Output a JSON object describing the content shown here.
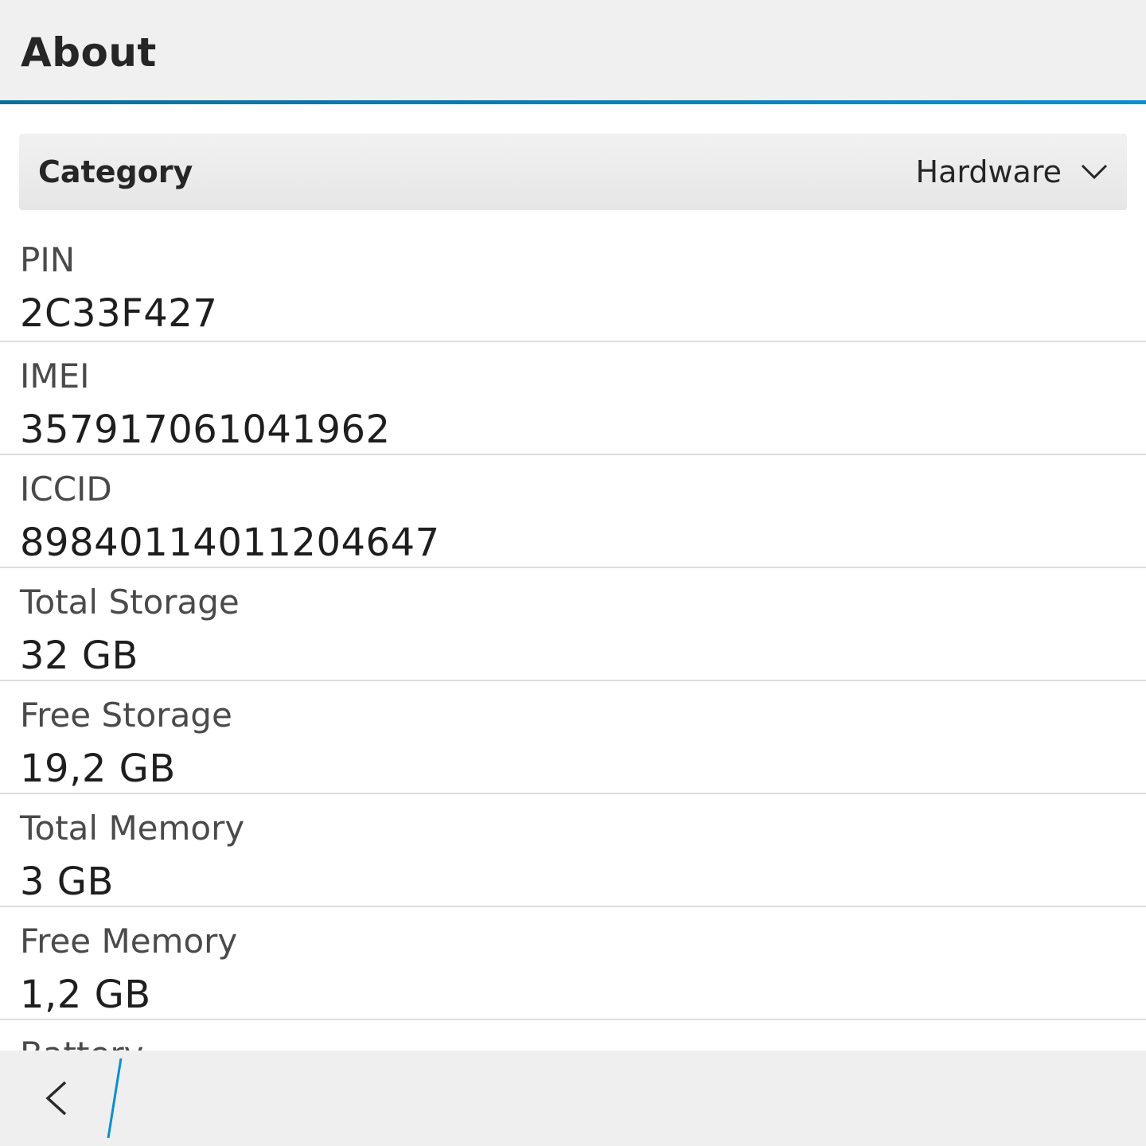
{
  "header": {
    "title": "About"
  },
  "category": {
    "label": "Category",
    "selected": "Hardware"
  },
  "items": [
    {
      "label": "PIN",
      "value": "2C33F427"
    },
    {
      "label": "IMEI",
      "value": "357917061041962"
    },
    {
      "label": "ICCID",
      "value": "89840114011204647"
    },
    {
      "label": "Total Storage",
      "value": "32 GB"
    },
    {
      "label": "Free Storage",
      "value": "19,2 GB"
    },
    {
      "label": "Total Memory",
      "value": "3 GB"
    },
    {
      "label": "Free Memory",
      "value": "1,2 GB"
    },
    {
      "label": "Battery",
      "value": ""
    }
  ],
  "colors": {
    "accent": "#0a8fd0",
    "header_bg": "#f0f0f0",
    "divider": "#dcdcdc"
  },
  "icons": {
    "dropdown": "chevron-down-icon",
    "back": "back-icon"
  }
}
